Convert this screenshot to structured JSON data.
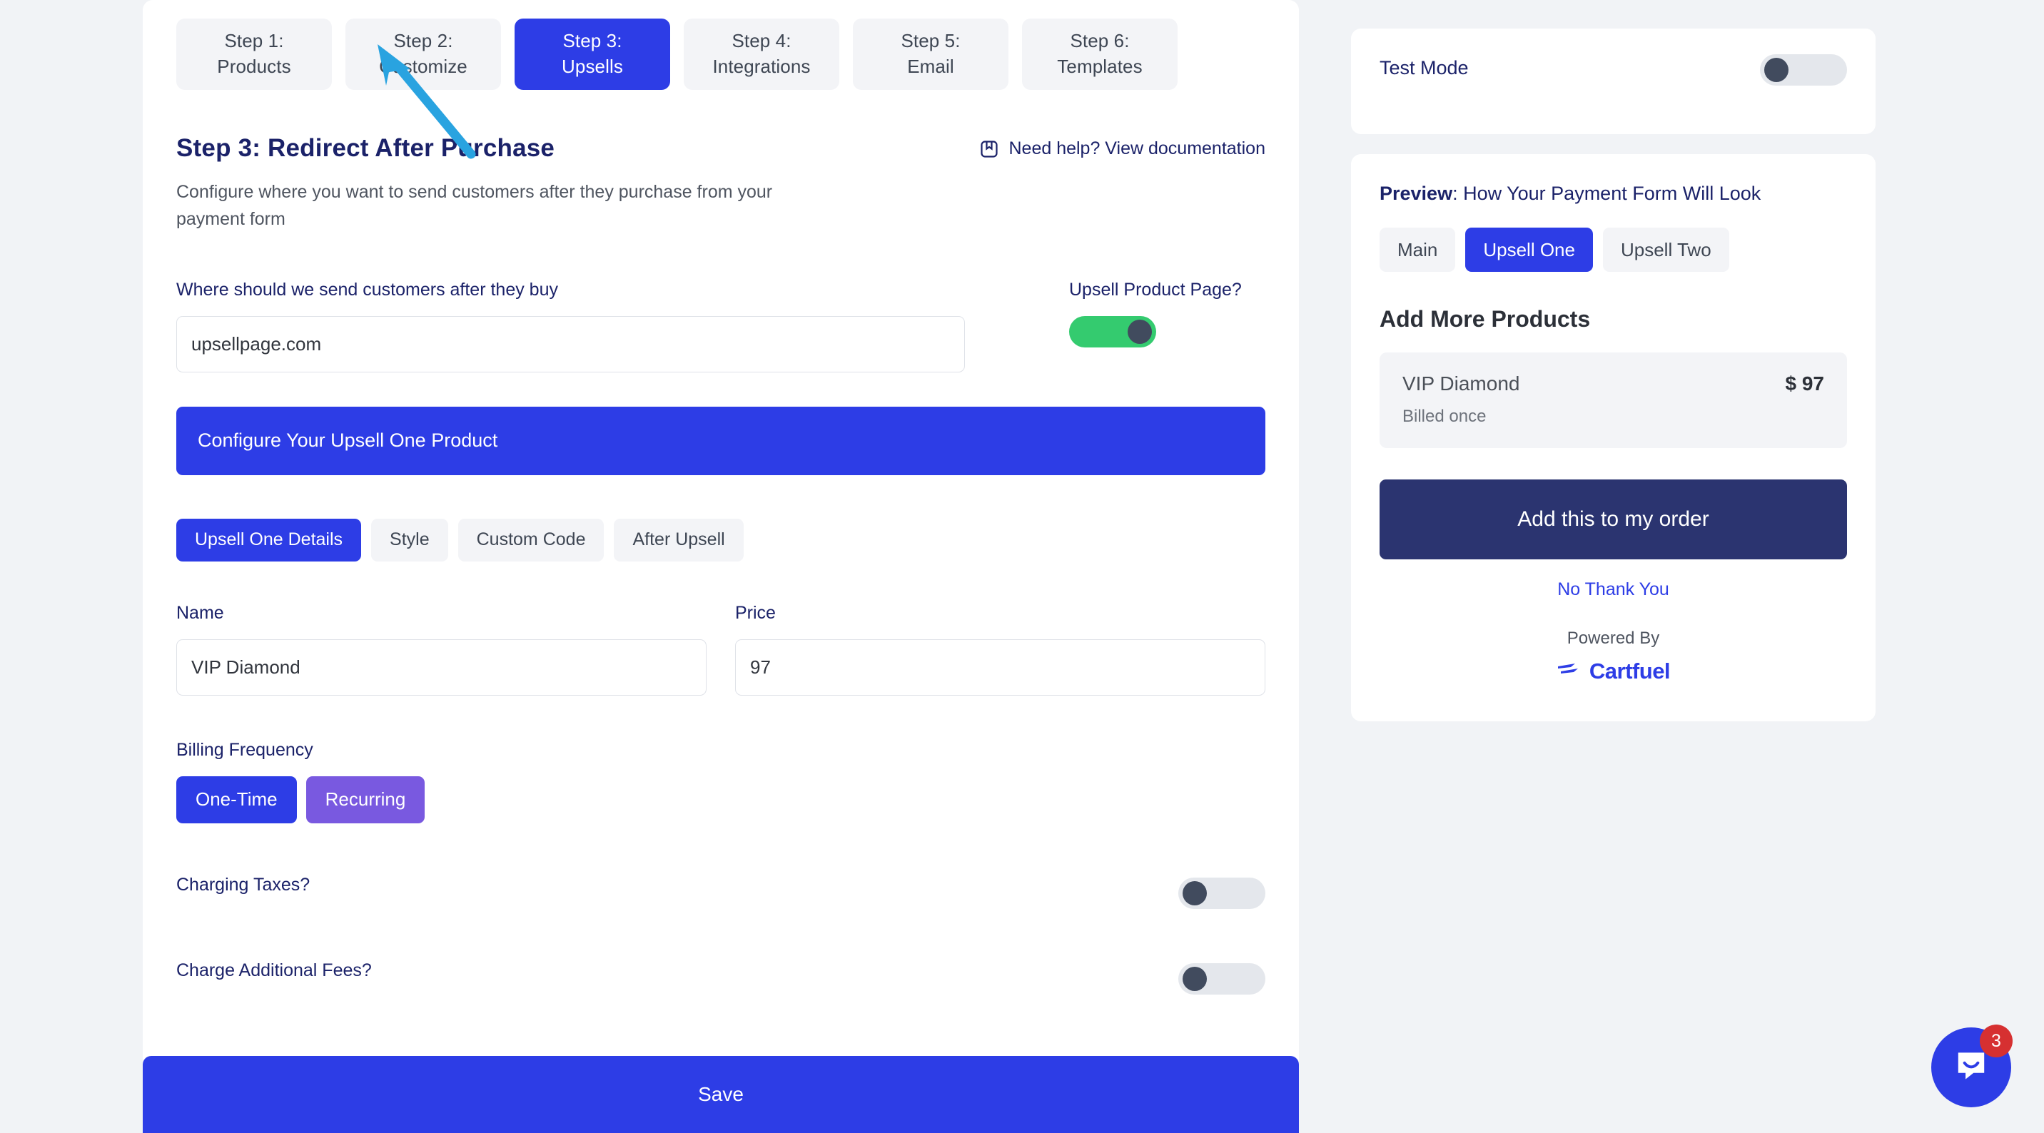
{
  "steps": [
    {
      "line1": "Step 1:",
      "line2": "Products",
      "active": false
    },
    {
      "line1": "Step 2:",
      "line2": "Customize",
      "active": false
    },
    {
      "line1": "Step 3:",
      "line2": "Upsells",
      "active": true
    },
    {
      "line1": "Step 4:",
      "line2": "Integrations",
      "active": false
    },
    {
      "line1": "Step 5:",
      "line2": "Email",
      "active": false
    },
    {
      "line1": "Step 6:",
      "line2": "Templates",
      "active": false
    }
  ],
  "header": {
    "title": "Step 3: Redirect After Purchase",
    "subtitle": "Configure where you want to send customers after they purchase from your payment form",
    "doc_link": "Need help? View documentation",
    "doc_icon": "bookmark-icon"
  },
  "redirect": {
    "label": "Where should we send customers after they buy",
    "value": "upsellpage.com",
    "placeholder": "upsellpage.com",
    "toggle_label": "Upsell Product Page?",
    "toggle_state": "on"
  },
  "configure_banner": "Configure Your Upsell One Product",
  "subtabs": [
    {
      "label": "Upsell One Details",
      "active": true
    },
    {
      "label": "Style",
      "active": false
    },
    {
      "label": "Custom Code",
      "active": false
    },
    {
      "label": "After Upsell",
      "active": false
    }
  ],
  "product_form": {
    "name_label": "Name",
    "name_value": "VIP Diamond",
    "price_label": "Price",
    "price_value": "97",
    "billing_label": "Billing Frequency",
    "billing_options": [
      {
        "label": "One-Time",
        "selected": true
      },
      {
        "label": "Recurring",
        "selected": false
      }
    ],
    "taxes_label": "Charging Taxes?",
    "taxes_state": "off",
    "fees_label": "Charge Additional Fees?",
    "fees_state": "off"
  },
  "save_label": "Save",
  "sidebar": {
    "test_mode_label": "Test Mode",
    "test_mode_state": "off",
    "preview_title_bold": "Preview",
    "preview_title_rest": ": How Your Payment Form Will Look",
    "preview_tabs": [
      {
        "label": "Main",
        "active": false
      },
      {
        "label": "Upsell One",
        "active": true
      },
      {
        "label": "Upsell Two",
        "active": false
      }
    ],
    "add_more_heading": "Add More Products",
    "product": {
      "name": "VIP Diamond",
      "price": "$ 97",
      "billing_note": "Billed once"
    },
    "cta_label": "Add this to my order",
    "decline_label": "No Thank You",
    "powered_by": "Powered By",
    "brand_name": "Cartfuel"
  },
  "chat": {
    "icon": "intercom-messenger-icon",
    "unread_count": "3"
  },
  "colors": {
    "primary_blue": "#2d3de6",
    "purple": "#7959e0",
    "green_toggle": "#34cb6f",
    "dark_navy_cta": "#2b3470",
    "annotation_blue": "#29a3e0",
    "badge_red": "#d63031"
  }
}
